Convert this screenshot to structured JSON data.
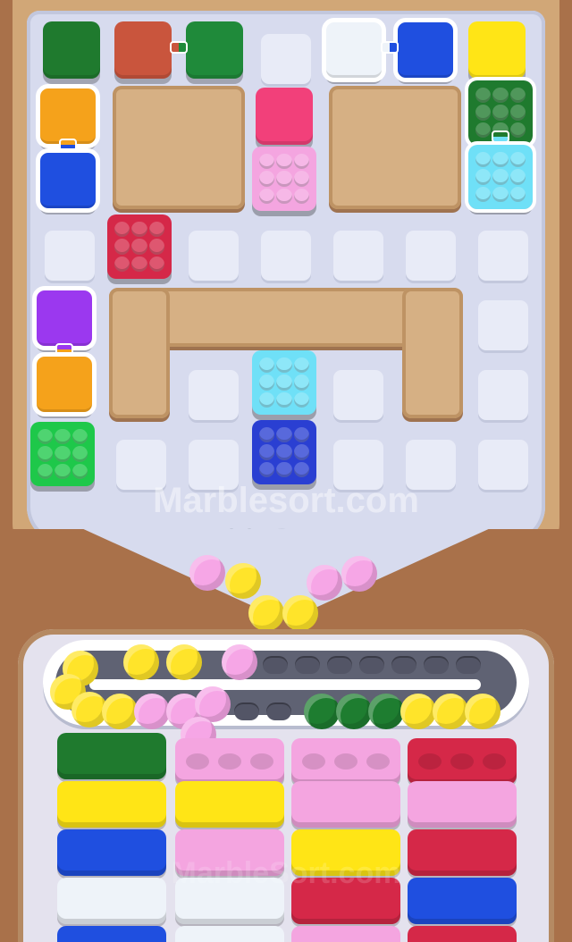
{
  "watermark": {
    "line1": "Marblesort.com",
    "line2": "MarbleSort.com",
    "tray_mark": "MarbleSort.com"
  },
  "colors": {
    "dark_green": "#1f7a2e",
    "red": "#c9553d",
    "green": "#1f8a3a",
    "light": "#eef3f9",
    "blue": "#1f4fe0",
    "yellow": "#ffe516",
    "orange": "#f5a21b",
    "pink": "#f2407a",
    "light_pink": "#f4a5e0",
    "crimson": "#d52848",
    "cyan": "#6fe0f7",
    "purple": "#9b38ef",
    "bright_green": "#1ec84a",
    "deep_blue": "#2a3fd2",
    "ball_pink": "#f6a6e6",
    "ball_yellow": "#ffe42a",
    "ball_green": "#1e7d30"
  },
  "top_row_blocks": [
    "dark_green",
    "red",
    "green",
    "light",
    "blue",
    "yellow"
  ],
  "stacks": [
    "pink",
    "crimson",
    "cyan",
    "deep_blue",
    "bright_green",
    "dark_green",
    "cyan"
  ],
  "balls_funnel": [
    "pink",
    "yellow",
    "yellow",
    "yellow",
    "pink",
    "pink"
  ],
  "balls_track_top": [
    "yellow",
    "yellow",
    "yellow",
    "pink"
  ],
  "balls_track_bottom": [
    "yellow",
    "yellow",
    "yellow",
    "pink",
    "pink",
    "pink",
    "green",
    "green",
    "green",
    "yellow",
    "yellow",
    "yellow"
  ],
  "bins": [
    [
      "dark_green",
      "light_pink",
      "light_pink",
      "crimson"
    ],
    [
      "yellow",
      "yellow",
      "light_pink",
      "light_pink"
    ],
    [
      "blue",
      "light_pink",
      "yellow",
      "crimson"
    ],
    [
      "light",
      "light",
      "crimson",
      "blue"
    ]
  ]
}
